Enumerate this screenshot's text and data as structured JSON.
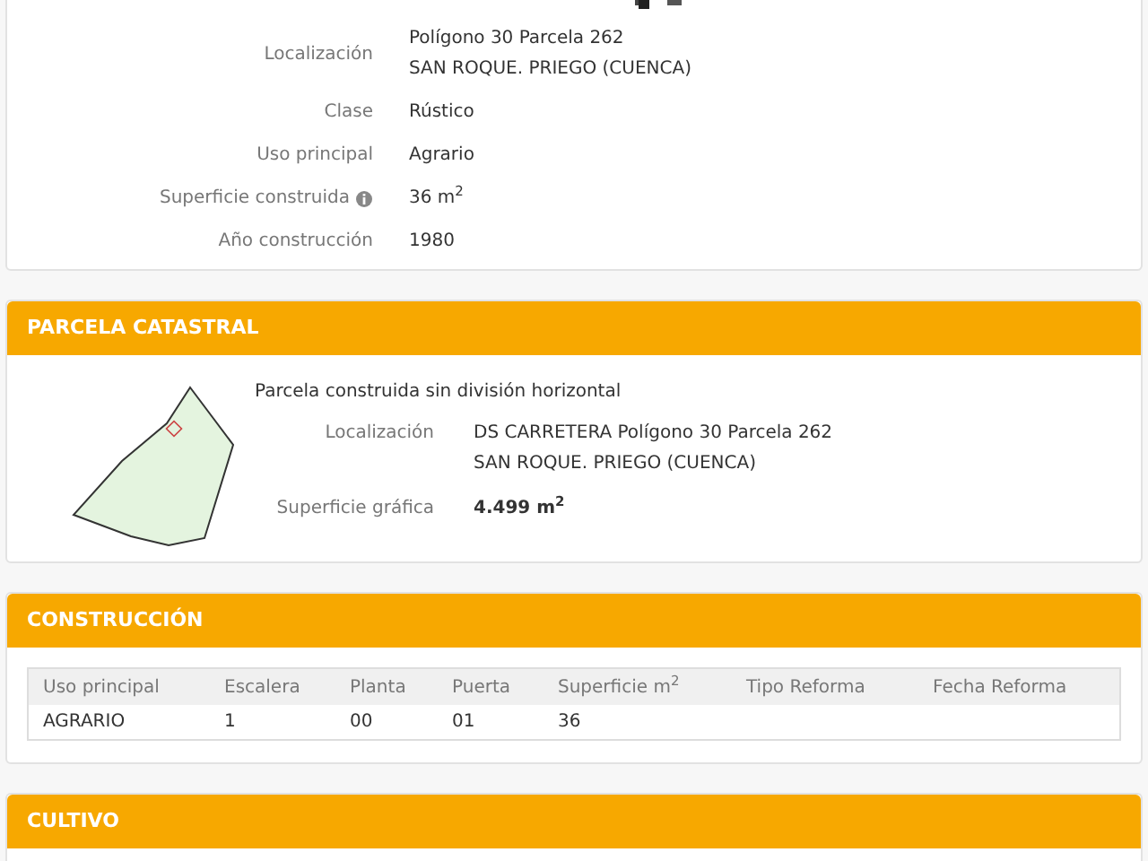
{
  "inmueble": {
    "fields": [
      {
        "kind": "ref"
      },
      {
        "kind": "plain",
        "label": "Localización",
        "lines": [
          "Polígono 30 Parcela 262",
          "SAN ROQUE. PRIEGO (CUENCA)"
        ]
      },
      {
        "kind": "plain",
        "label": "Clase",
        "lines": [
          "Rústico"
        ]
      },
      {
        "kind": "plain",
        "label": "Uso principal",
        "lines": [
          "Agrario"
        ]
      },
      {
        "kind": "info",
        "label": "Superficie construida",
        "lines": [
          "36 m$^{2}$"
        ]
      },
      {
        "kind": "plain",
        "label": "Año construcción",
        "lines": [
          "1980"
        ]
      }
    ]
  },
  "parcela": {
    "title": "PARCELA CATASTRAL",
    "subtitle": "Parcela construida sin división horizontal",
    "fields": [
      {
        "label": "Localización",
        "lines": [
          "DS CARRETERA Polígono 30 Parcela 262",
          "SAN ROQUE. PRIEGO (CUENCA)"
        ]
      },
      {
        "label": "Superficie gráfica",
        "lines": [
          "4.499 m$^{2}$"
        ],
        "bold": true
      }
    ]
  },
  "construccion": {
    "title": "CONSTRUCCIÓN",
    "columns": [
      "Uso principal",
      "Escalera",
      "Planta",
      "Puerta",
      "Superficie m$^{2}$",
      "Tipo Reforma",
      "Fecha Reforma"
    ],
    "rows": [
      [
        "AGRARIO",
        "1",
        "00",
        "01",
        "36",
        "",
        ""
      ]
    ]
  },
  "cultivo": {
    "title": "CULTIVO"
  }
}
